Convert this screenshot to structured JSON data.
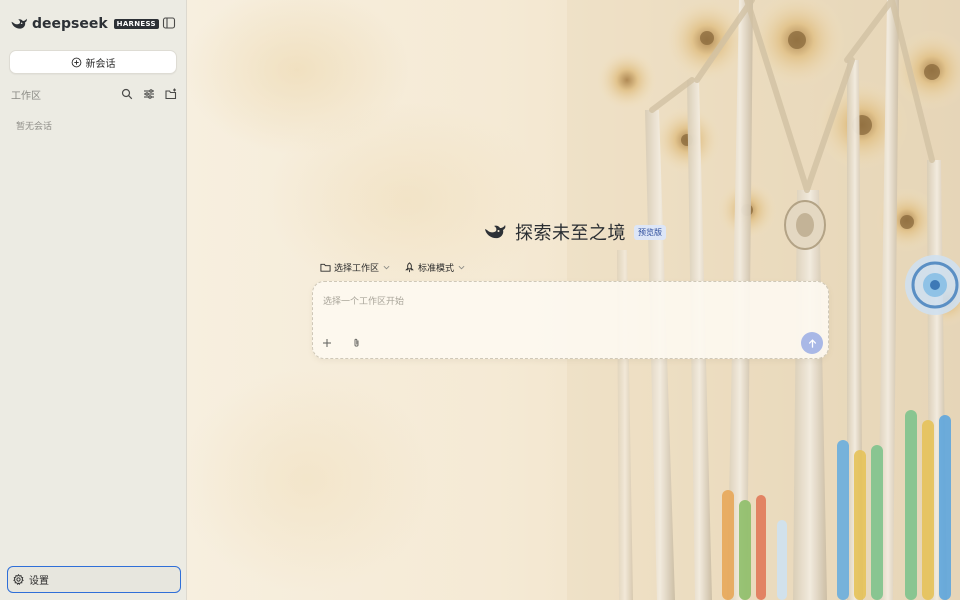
{
  "brand": {
    "name": "deepseek",
    "badge": "HARNESS"
  },
  "sidebar": {
    "new_chat_label": "新会话",
    "workspace_label": "工作区",
    "empty_text": "暂无会话",
    "settings_label": "设置",
    "icons": [
      "sidebar-toggle-icon",
      "search-icon",
      "filter-icon",
      "new-folder-icon",
      "plus-circle-icon",
      "gear-icon"
    ]
  },
  "main": {
    "title": "探索未至之境",
    "badge": "预览版",
    "workspace_selector": "选择工作区",
    "mode_selector": "标准模式",
    "composer_placeholder": "选择一个工作区开始"
  },
  "colors": {
    "accent": "#2f6fd8",
    "send_button": "#a9b8e6",
    "brand_dark": "#2d3136"
  }
}
